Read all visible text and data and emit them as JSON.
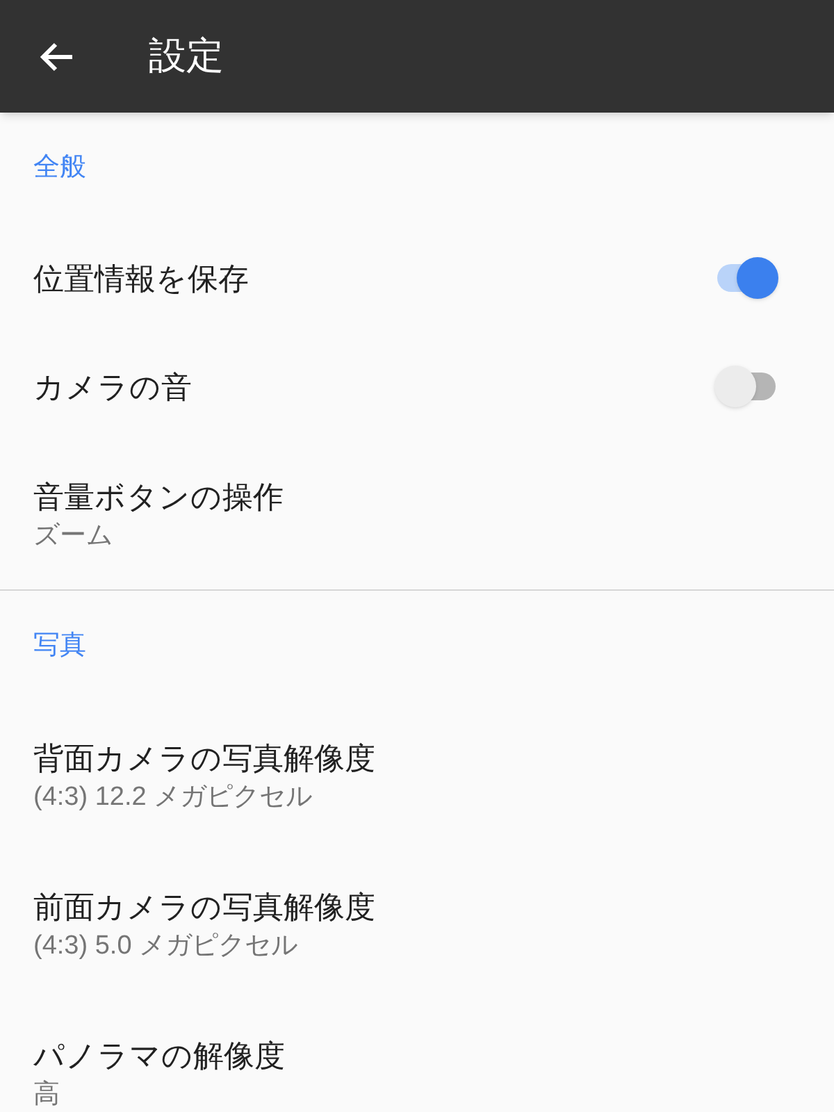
{
  "app_bar": {
    "title": "設定"
  },
  "sections": [
    {
      "title": "全般",
      "items": [
        {
          "kind": "toggle",
          "label": "位置情報を保存",
          "on": true
        },
        {
          "kind": "toggle",
          "label": "カメラの音",
          "on": false
        },
        {
          "kind": "detail",
          "label": "音量ボタンの操作",
          "value": "ズーム"
        }
      ]
    },
    {
      "title": "写真",
      "items": [
        {
          "kind": "detail",
          "label": "背面カメラの写真解像度",
          "value": "(4:3) 12.2 メガピクセル"
        },
        {
          "kind": "detail",
          "label": "前面カメラの写真解像度",
          "value": "(4:3) 5.0 メガピクセル"
        },
        {
          "kind": "detail",
          "label": "パノラマの解像度",
          "value": "高"
        }
      ]
    }
  ]
}
